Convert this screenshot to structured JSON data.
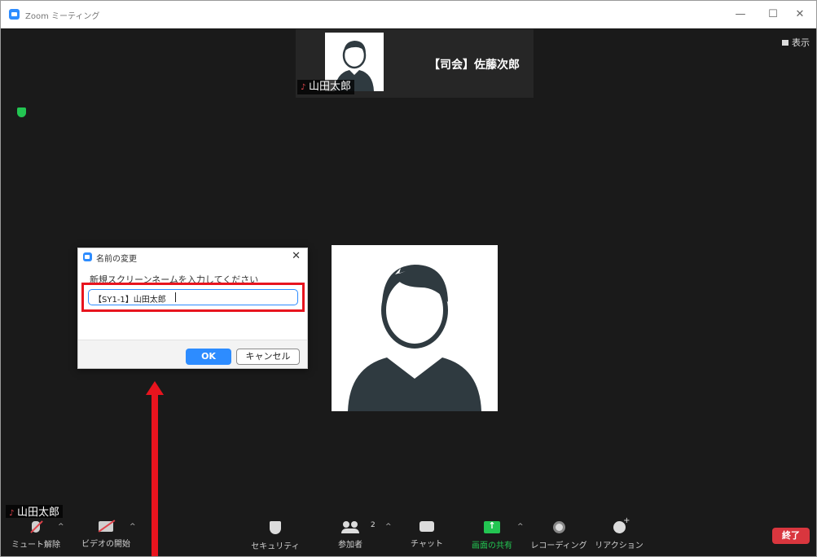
{
  "window": {
    "title": "Zoom ミーティング",
    "controls": {
      "minimize": "—",
      "maximize": "☐",
      "close": "✕"
    }
  },
  "view_button": {
    "label": "表示"
  },
  "participants_strip": [
    {
      "name": "山田太郎",
      "has_photo": true,
      "muted": true
    },
    {
      "name": "【司会】佐藤次郎",
      "has_photo": false
    }
  ],
  "rename_dialog": {
    "title": "名前の変更",
    "prompt": "新規スクリーンネームを入力してください",
    "input_value": "【SY1-1】山田太郎",
    "ok_label": "OK",
    "cancel_label": "キャンセル"
  },
  "self_view": {
    "name": "山田太郎",
    "muted": true
  },
  "toolbar": {
    "items": [
      {
        "icon": "mic-muted-icon",
        "label": "ミュート解除"
      },
      {
        "icon": "video-off-icon",
        "label": "ビデオの開始"
      },
      {
        "icon": "security-icon",
        "label": "セキュリティ"
      },
      {
        "icon": "participants-icon",
        "label": "参加者",
        "count": "2"
      },
      {
        "icon": "chat-icon",
        "label": "チャット"
      },
      {
        "icon": "share-screen-icon",
        "label": "画面の共有"
      },
      {
        "icon": "record-icon",
        "label": "レコーディング"
      },
      {
        "icon": "reaction-icon",
        "label": "リアクション"
      }
    ],
    "end_label": "終了"
  },
  "colors": {
    "accent_blue": "#2d8cff",
    "share_green": "#23c552",
    "end_red": "#d9363e",
    "annotation_red": "#e8141e"
  }
}
